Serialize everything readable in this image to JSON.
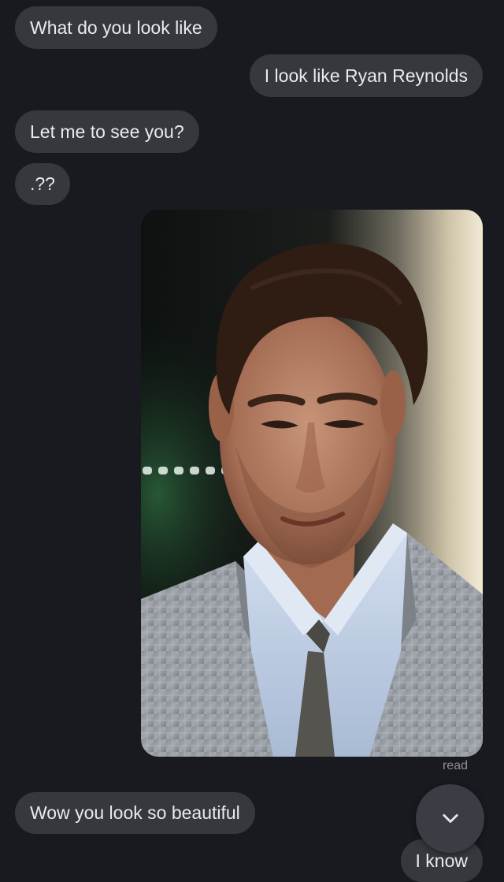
{
  "messages": [
    {
      "text": "What do you look like",
      "side": "incoming"
    },
    {
      "text": "I look like Ryan Reynolds",
      "side": "outgoing"
    },
    {
      "text": "Let me to see you?",
      "side": "incoming"
    },
    {
      "text": ".??",
      "side": "incoming"
    },
    {
      "type": "image",
      "side": "outgoing"
    },
    {
      "text": "Wow you look so beautiful",
      "side": "incoming"
    },
    {
      "text": "I know",
      "side": "outgoing"
    }
  ],
  "receipt": "read",
  "icons": {
    "scroll_down": "chevron-down-icon"
  },
  "colors": {
    "background": "#181a20",
    "bubble": "#36383d",
    "bubble_text": "#e9eaee",
    "receipt_text": "#8e9096"
  }
}
